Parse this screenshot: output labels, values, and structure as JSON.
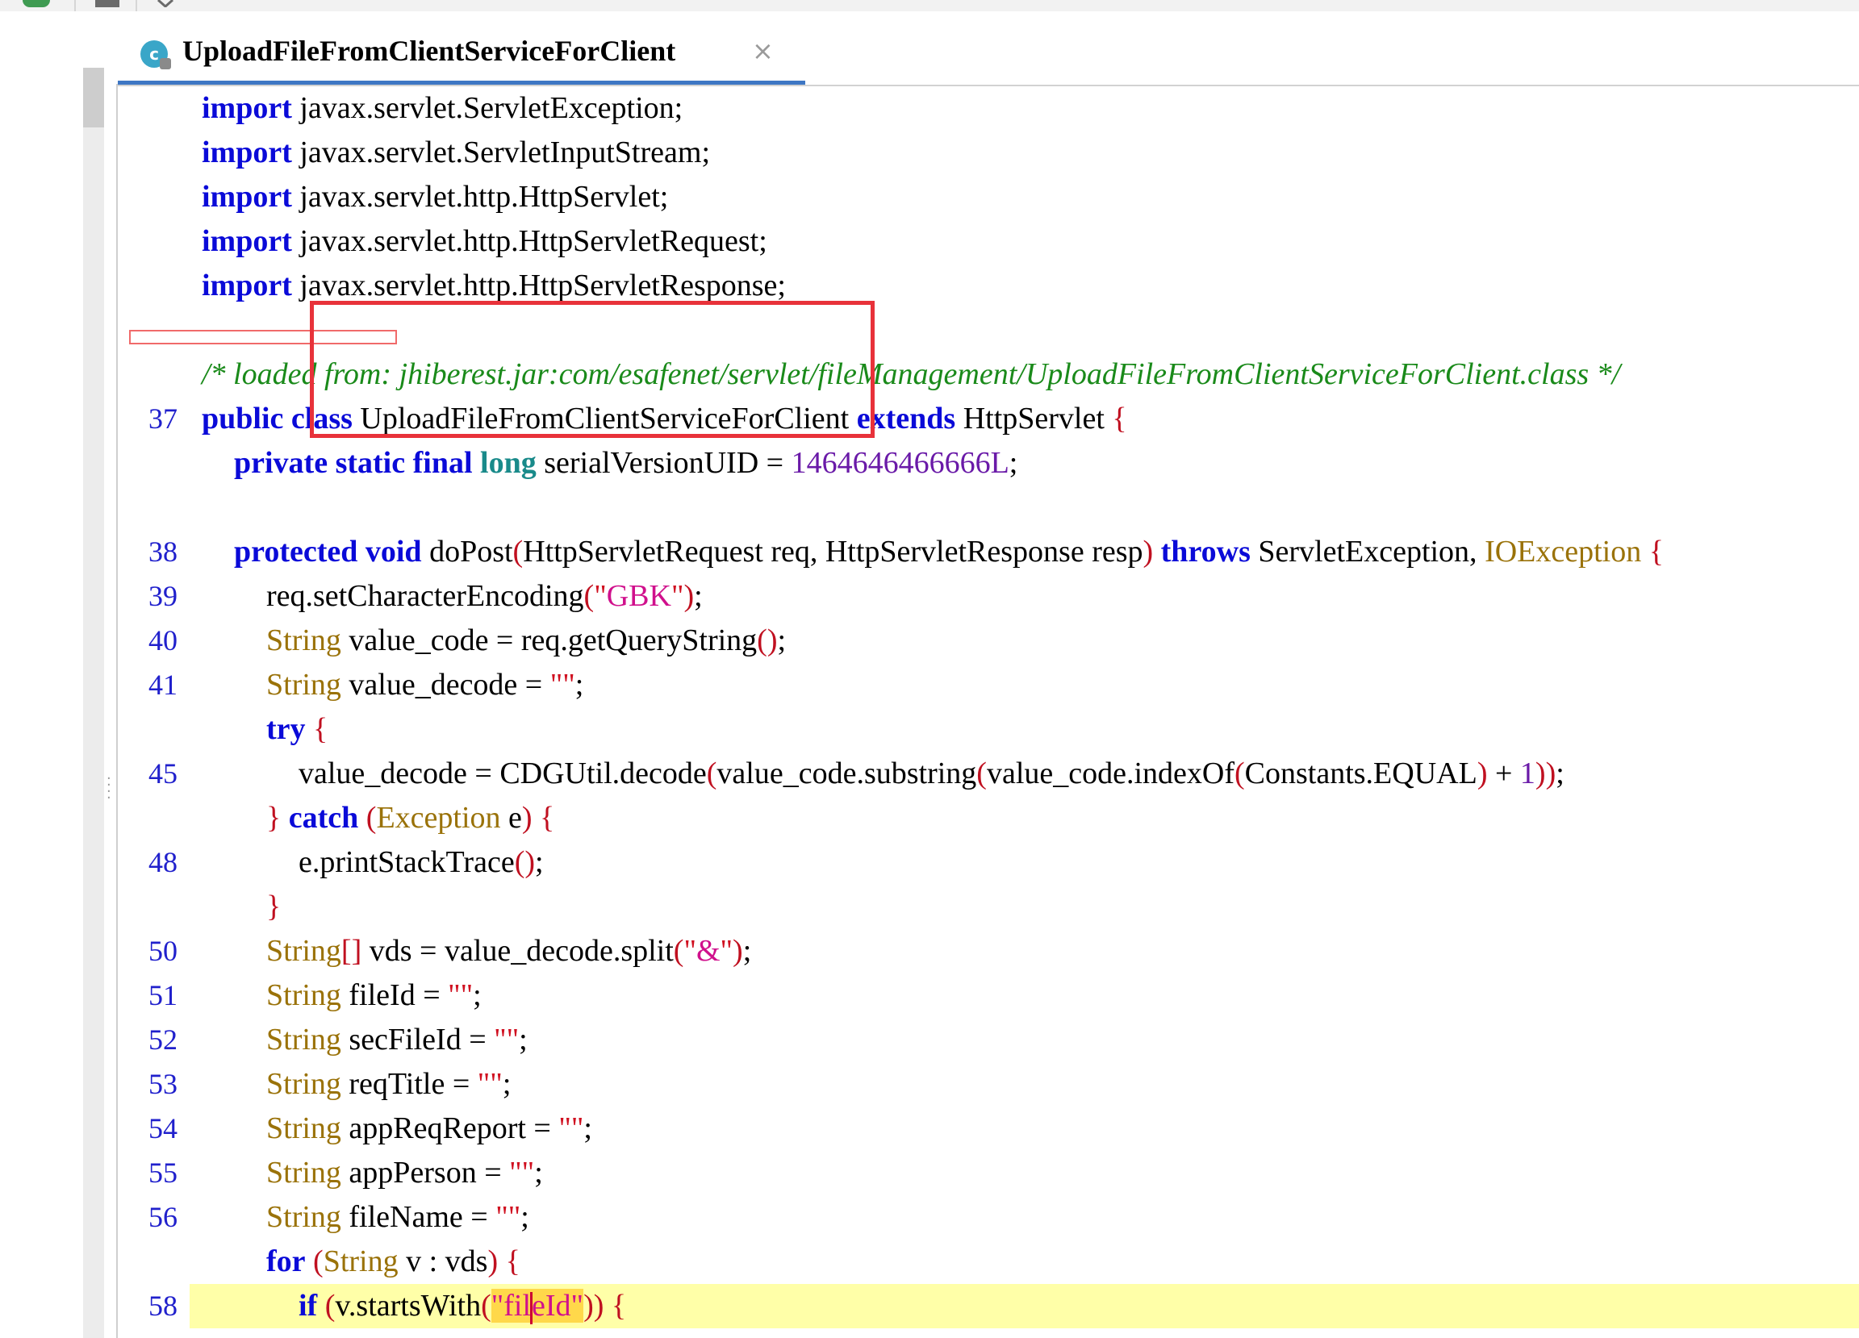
{
  "toolbar": {
    "icons": [
      "run-icon",
      "stop-icon",
      "build-icon"
    ]
  },
  "tab": {
    "title": "UploadFileFromClientServiceForClient",
    "icon": "class-icon",
    "icon_glyph": "c",
    "close_glyph": "×"
  },
  "colors": {
    "keyword": "#0a0ad8",
    "type": "#9a7209",
    "string": "#d0108c",
    "comment": "#1a8a1a",
    "number": "#6a1aa8",
    "line_number": "#2020cc",
    "current_line": "#ffffa8",
    "annotation_box": "#e8323a"
  },
  "editor": {
    "lines": [
      {
        "num": "",
        "text": "import javax.servlet.ServletException;"
      },
      {
        "num": "",
        "text": "import javax.servlet.ServletInputStream;"
      },
      {
        "num": "",
        "text": "import javax.servlet.http.HttpServlet;"
      },
      {
        "num": "",
        "text": "import javax.servlet.http.HttpServletRequest;"
      },
      {
        "num": "",
        "text": "import javax.servlet.http.HttpServletResponse;"
      },
      {
        "num": "",
        "text": ""
      },
      {
        "num": "",
        "text": "/* loaded from: jhiberest.jar:com/esafenet/servlet/fileManagement/UploadFileFromClientServiceForClient.class */"
      },
      {
        "num": "37",
        "text": "public class UploadFileFromClientServiceForClient extends HttpServlet {"
      },
      {
        "num": "",
        "text": "private static final long serialVersionUID = 1464646466666L;"
      },
      {
        "num": "",
        "text": ""
      },
      {
        "num": "38",
        "text": "protected void doPost(HttpServletRequest req, HttpServletResponse resp) throws ServletException, IOException {"
      },
      {
        "num": "39",
        "text": "req.setCharacterEncoding(\"GBK\");"
      },
      {
        "num": "40",
        "text": "String value_code = req.getQueryString();"
      },
      {
        "num": "41",
        "text": "String value_decode = \"\";"
      },
      {
        "num": "",
        "text": "try {"
      },
      {
        "num": "45",
        "text": "value_decode = CDGUtil.decode(value_code.substring(value_code.indexOf(Constants.EQUAL) + 1));"
      },
      {
        "num": "",
        "text": "} catch (Exception e) {"
      },
      {
        "num": "48",
        "text": "e.printStackTrace();"
      },
      {
        "num": "",
        "text": "}"
      },
      {
        "num": "50",
        "text": "String[] vds = value_decode.split(\"&\");"
      },
      {
        "num": "51",
        "text": "String fileId = \"\";"
      },
      {
        "num": "52",
        "text": "String secFileId = \"\";"
      },
      {
        "num": "53",
        "text": "String reqTitle = \"\";"
      },
      {
        "num": "54",
        "text": "String appReqReport = \"\";"
      },
      {
        "num": "55",
        "text": "String appPerson = \"\";"
      },
      {
        "num": "56",
        "text": "String fileName = \"\";"
      },
      {
        "num": "",
        "text": "for (String v : vds) {"
      },
      {
        "num": "58",
        "text": "if (v.startsWith(\"fileId\")) {"
      }
    ],
    "current_line_num": "58"
  }
}
